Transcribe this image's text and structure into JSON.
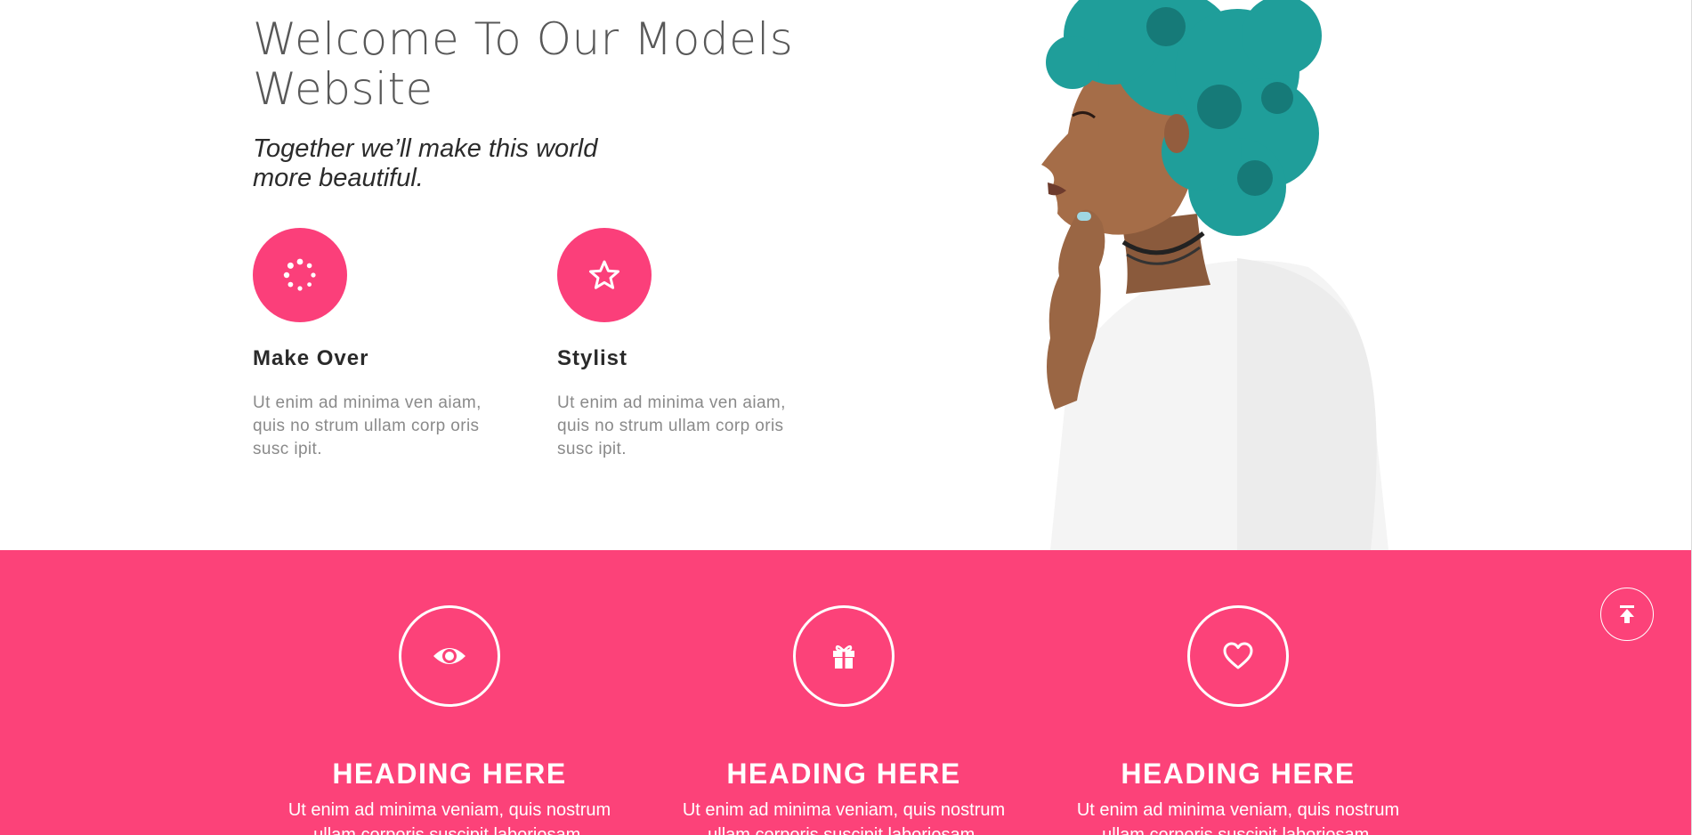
{
  "hero": {
    "title_line1": "Welcome To Our Models",
    "title_line2": "Website",
    "tagline_line1": "Together we’ll make this world",
    "tagline_line2": "more beautiful.",
    "features": [
      {
        "icon": "spinner-icon",
        "title": "Make Over",
        "text": "Ut enim ad minima ven aiam, quis no strum ullam corp oris susc ipit."
      },
      {
        "icon": "star-icon",
        "title": "Stylist",
        "text": "Ut enim ad minima ven aiam, quis no strum ullam corp oris susc ipit."
      }
    ]
  },
  "services": {
    "items": [
      {
        "icon": "eye-icon",
        "heading": "HEADING HERE",
        "text": "Ut enim ad minima veniam, quis nostrum ullam corporis suscipit laboriosam."
      },
      {
        "icon": "gift-icon",
        "heading": "HEADING HERE",
        "text": "Ut enim ad minima veniam, quis nostrum ullam corporis suscipit laboriosam."
      },
      {
        "icon": "heart-icon",
        "heading": "HEADING HERE",
        "text": "Ut enim ad minima veniam, quis nostrum ullam corporis suscipit laboriosam."
      }
    ]
  },
  "back_to_top": {
    "icon": "arrow-up-to-line-icon"
  },
  "colors": {
    "accent": "#fc4279",
    "heading_text": "#2a2a2a",
    "body_text": "#8a8a8a",
    "white": "#ffffff",
    "hair": "#1f9e9a"
  }
}
